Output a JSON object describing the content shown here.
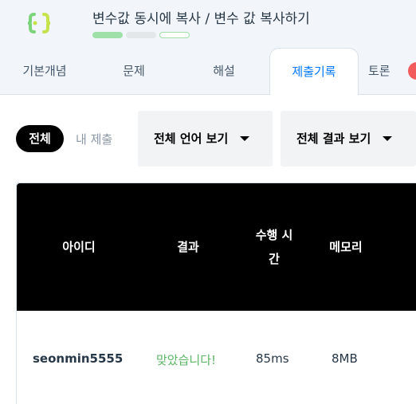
{
  "header": {
    "title": "변수값 동시에 복사 / 변수 값 복사하기",
    "progress_colors": [
      "#9fe0a8",
      "#e3e7ea",
      "#9fe0a8"
    ]
  },
  "tabs": [
    {
      "label": "기본개념",
      "active": false
    },
    {
      "label": "문제",
      "active": false
    },
    {
      "label": "해설",
      "active": false
    },
    {
      "label": "제출기록",
      "active": true
    },
    {
      "label": "토론",
      "active": false
    }
  ],
  "filters": {
    "all_label": "전체",
    "mine_label": "내 제출",
    "language_dropdown": "전체 언어 보기",
    "result_dropdown": "전체 결과 보기"
  },
  "table": {
    "columns": [
      "아이디",
      "결과",
      "수행 시간",
      "메모리"
    ],
    "rows": [
      {
        "id": "seonmin5555",
        "result": "맞았습니다!",
        "time": "85ms",
        "memory": "8MB"
      }
    ]
  },
  "colors": {
    "accent": "#0078ff",
    "success": "#5bb665",
    "header_bg": "#f2f5f9"
  }
}
